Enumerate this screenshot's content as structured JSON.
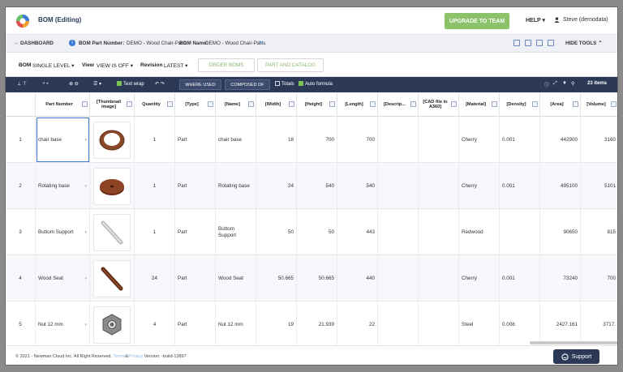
{
  "app": {
    "title": "BOM (Editing)",
    "upgrade_label": "UPGRADE TO TEAM",
    "help_label": "HELP ▾",
    "user_label": "Steve (demodata)"
  },
  "breadcrumb": {
    "dashboard": "← DASHBOARD",
    "part_number_label": "BOM Part Number:",
    "part_number_value": "DEMO - Wood Chair-Parts",
    "bom_name_label": "BOM Name:",
    "bom_name_value": "DEMO - Wood Chair-Parts",
    "hide_tools": "HIDE TOOLS ⌃"
  },
  "toolrow": {
    "bom_label": "BOM",
    "bom_value": "SINGLE LEVEL ▾",
    "view_label": "View",
    "view_value": "VIEW IS OFF ▾",
    "revision_label": "Revision",
    "revision_value": "LATEST ▾",
    "order_boms": "ORDER BOMS",
    "part_catalog": "PART AND CATALOG"
  },
  "gridbar": {
    "text_wrap": "Text wrap",
    "where_used": "WHERE USED",
    "composed_of": "COMPOSED OF",
    "totals": "Totals",
    "auto_formula": "Auto formula",
    "items_count": "23 items"
  },
  "columns": [
    "Part Number",
    "[Thumbnail image]",
    "Quantity",
    "[Type]",
    "[Name]",
    "[Width]",
    "[Height]",
    "[Length]",
    "[Descrip...",
    "[CAD file in A360]",
    "[Material]",
    "[Density]",
    "[Area]",
    "[Volume]"
  ],
  "rows": [
    {
      "idx": "1",
      "part": "chair base",
      "qty": "1",
      "type": "Part",
      "name": "chair base",
      "width": "18",
      "height": "700",
      "length": "700",
      "desc": "",
      "cad": "",
      "material": "Cherry",
      "density": "0.001",
      "area": "442900",
      "volume": "3160",
      "thumb": "ring"
    },
    {
      "idx": "2",
      "part": "Rotating base",
      "qty": "1",
      "type": "Part",
      "name": "Rotating base",
      "width": "24",
      "height": "540",
      "length": "540",
      "desc": "",
      "cad": "",
      "material": "Cherry",
      "density": "0.001",
      "area": "495100",
      "volume": "5101",
      "thumb": "disc"
    },
    {
      "idx": "3",
      "part": "Buttom Support",
      "qty": "1",
      "type": "Part",
      "name": "Buttom Support",
      "width": "50",
      "height": "50",
      "length": "443",
      "desc": "",
      "cad": "",
      "material": "Redwood",
      "density": "",
      "area": "90650",
      "volume": "815",
      "thumb": "rod"
    },
    {
      "idx": "4",
      "part": "Wood Seat",
      "qty": "24",
      "type": "Part",
      "name": "Wood Seat",
      "width": "50.665",
      "height": "50.665",
      "length": "440",
      "desc": "",
      "cad": "",
      "material": "Cherry",
      "density": "0.001",
      "area": "73240",
      "volume": "700",
      "thumb": "stick"
    },
    {
      "idx": "5",
      "part": "Nut 12 mm",
      "qty": "4",
      "type": "Part",
      "name": "Nut 12 mm",
      "width": "19",
      "height": "21.939",
      "length": "22",
      "desc": "",
      "cad": "",
      "material": "Steel",
      "density": "0.008",
      "area": "2427.161",
      "volume": "3717.",
      "thumb": "nut"
    }
  ],
  "footer": {
    "copyright": "© 2021 - Newman Cloud Inc. All Right Reserved.",
    "terms": "Terms",
    "amp": "&",
    "privacy": "Privacy",
    "version": "Version: -build-13897",
    "support": "Support"
  },
  "colors": {
    "navy": "#2c3956",
    "green": "#8bc26a",
    "accent": "#3b7bd6"
  }
}
